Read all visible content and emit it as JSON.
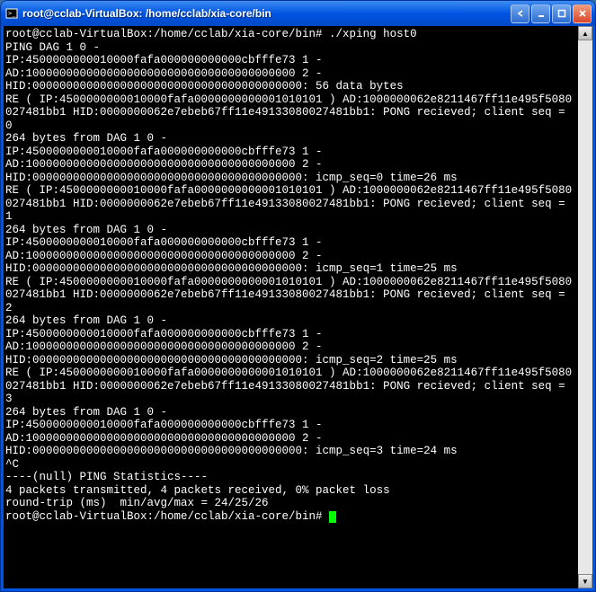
{
  "titlebar": {
    "title": "root@cclab-VirtualBox: /home/cclab/xia-core/bin"
  },
  "terminal": {
    "prompt1": "root@cclab-VirtualBox:/home/cclab/xia-core/bin#",
    "command1": " ./xping host0",
    "lines": [
      "PING DAG 1 0 -",
      "IP:4500000000010000fafa000000000000cbfffe73 1 -",
      "AD:1000000000000000000000000000000000000000 2 -",
      "HID:0000000000000000000000000000000000000000: 56 data bytes",
      "RE ( IP:4500000000010000fafa0000000000001010101 ) AD:1000000062e8211467ff11e495f5080027481bb1 HID:0000000062e7ebeb67ff11e49133080027481bb1: PONG recieved; client seq = 0",
      "264 bytes from DAG 1 0 -",
      "IP:4500000000010000fafa000000000000cbfffe73 1 -",
      "AD:1000000000000000000000000000000000000000 2 -",
      "HID:0000000000000000000000000000000000000000: icmp_seq=0 time=26 ms",
      "RE ( IP:4500000000010000fafa0000000000001010101 ) AD:1000000062e8211467ff11e495f5080027481bb1 HID:0000000062e7ebeb67ff11e49133080027481bb1: PONG recieved; client seq = 1",
      "264 bytes from DAG 1 0 -",
      "IP:4500000000010000fafa000000000000cbfffe73 1 -",
      "AD:1000000000000000000000000000000000000000 2 -",
      "HID:0000000000000000000000000000000000000000: icmp_seq=1 time=25 ms",
      "RE ( IP:4500000000010000fafa0000000000001010101 ) AD:1000000062e8211467ff11e495f5080027481bb1 HID:0000000062e7ebeb67ff11e49133080027481bb1: PONG recieved; client seq = 2",
      "264 bytes from DAG 1 0 -",
      "IP:4500000000010000fafa000000000000cbfffe73 1 -",
      "AD:1000000000000000000000000000000000000000 2 -",
      "HID:0000000000000000000000000000000000000000: icmp_seq=2 time=25 ms",
      "RE ( IP:4500000000010000fafa0000000000001010101 ) AD:1000000062e8211467ff11e495f5080027481bb1 HID:0000000062e7ebeb67ff11e49133080027481bb1: PONG recieved; client seq = 3",
      "264 bytes from DAG 1 0 -",
      "IP:4500000000010000fafa000000000000cbfffe73 1 -",
      "AD:1000000000000000000000000000000000000000 2 -",
      "HID:0000000000000000000000000000000000000000: icmp_seq=3 time=24 ms",
      "^C",
      "",
      "----(null) PING Statistics----",
      "4 packets transmitted, 4 packets received, 0% packet loss",
      "round-trip (ms)  min/avg/max = 24/25/26"
    ],
    "prompt2": "root@cclab-VirtualBox:/home/cclab/xia-core/bin# "
  }
}
